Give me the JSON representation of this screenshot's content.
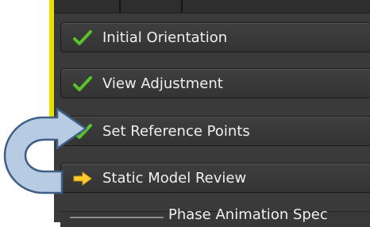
{
  "workflow": {
    "steps": [
      {
        "label": "Initial Orientation",
        "status_icon": "check-icon",
        "status": "complete"
      },
      {
        "label": "View Adjustment",
        "status_icon": "check-icon",
        "status": "complete"
      },
      {
        "label": "Set Reference Points",
        "status_icon": "check-icon",
        "status": "complete"
      },
      {
        "label": "Static Model Review",
        "status_icon": "arrow-right-icon",
        "status": "current"
      }
    ],
    "partial_step": {
      "label": "Phase Animation Spec"
    }
  },
  "colors": {
    "accent_bar": "#e7e000",
    "check": "#58c22b",
    "current_arrow": "#ffcc2e",
    "callout_fill": "#b7cbe3",
    "callout_stroke": "#3f5f86",
    "panel_bg": "#3a3a3a"
  }
}
